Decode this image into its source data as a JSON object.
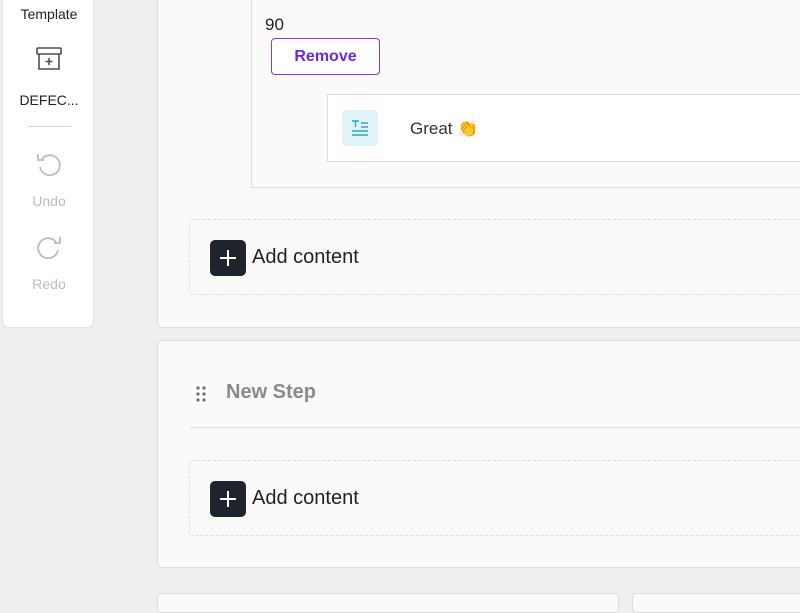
{
  "sidebar": {
    "template_label": "Template",
    "defect_label": "DEFEC...",
    "undo_label": "Undo",
    "redo_label": "Redo"
  },
  "answer_block": {
    "score": "90",
    "remove_label": "Remove",
    "answer_text": "Great 👏"
  },
  "add_content_label": "Add content",
  "step": {
    "title": "New Step",
    "add_content_label": "Add content"
  },
  "colors": {
    "accent": "#7c3aed",
    "add_button": "#1f232b",
    "text_icon_bg": "#e0f4f7",
    "text_icon": "#2aa8c4"
  }
}
